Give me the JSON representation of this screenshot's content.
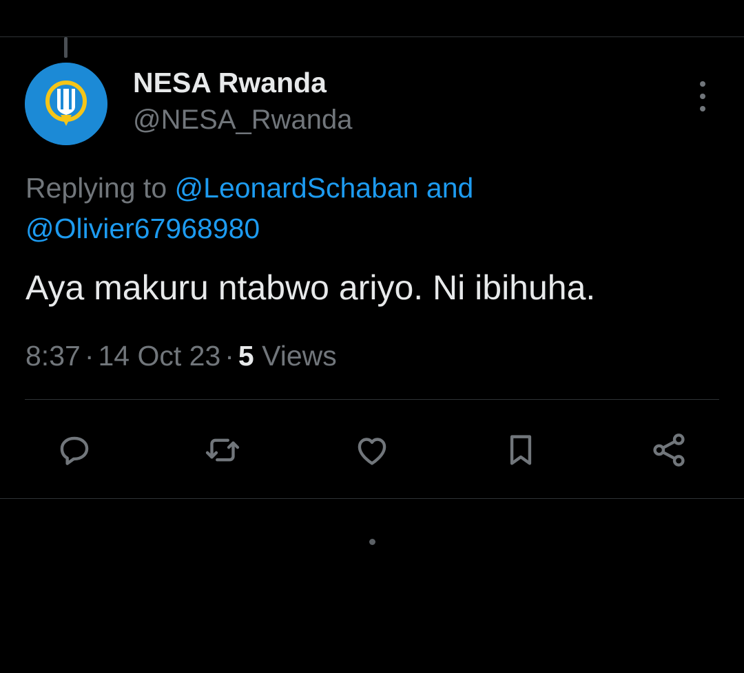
{
  "tweet": {
    "author": {
      "display_name": "NESA Rwanda",
      "handle": "@NESA_Rwanda",
      "avatar_icon": "nesa-logo-icon"
    },
    "replying_prefix": "Replying to",
    "replying_to": [
      "@LeonardSchaban",
      "@Olivier67968980"
    ],
    "replying_joiner": "and",
    "text": "Aya makuru ntabwo ariyo. Ni ibihuha.",
    "time": "8:37",
    "date": "14 Oct 23",
    "views_count": "5",
    "views_label": "Views",
    "separator": "·"
  },
  "actions": [
    {
      "name": "reply",
      "icon": "reply-icon"
    },
    {
      "name": "retweet",
      "icon": "retweet-icon"
    },
    {
      "name": "like",
      "icon": "heart-icon"
    },
    {
      "name": "bookmark",
      "icon": "bookmark-icon"
    },
    {
      "name": "share",
      "icon": "share-icon"
    }
  ],
  "colors": {
    "background": "#000000",
    "primary_text": "#e7e9ea",
    "secondary_text": "#71767b",
    "accent": "#1d9bf0",
    "divider": "#2f3336",
    "avatar_bg": "#1c8ad6",
    "logo_yellow": "#f5c518"
  }
}
